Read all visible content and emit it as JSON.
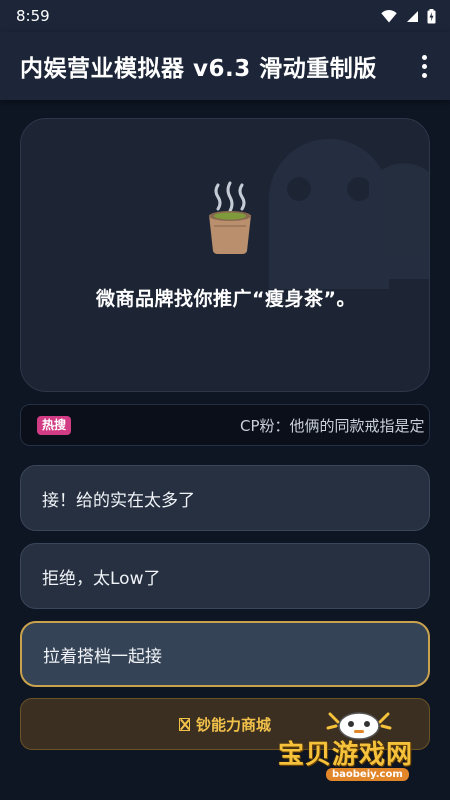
{
  "status_bar": {
    "time": "8:59"
  },
  "app_bar": {
    "title": "内娱营业模拟器 v6.3 滑动重制版"
  },
  "event_card": {
    "icon": "tea-cup-icon",
    "text": "微商品牌找你推广“瘦身茶”。"
  },
  "ticker": {
    "badge": "热搜",
    "text": "CP粉：他俩的同款戒指是定"
  },
  "choices": [
    {
      "label": "接！给的实在太多了"
    },
    {
      "label": "拒绝，太Low了"
    },
    {
      "label": "拉着搭档一起接"
    }
  ],
  "shop": {
    "label": "钞能力商城",
    "icon": "money-box-icon"
  },
  "watermark": {
    "brand": "宝贝游戏网",
    "url": "baobeiy.com"
  },
  "colors": {
    "accent_gold": "#f2c14a",
    "hot_pink": "#d23c85",
    "selected_border": "#c9a24e"
  }
}
